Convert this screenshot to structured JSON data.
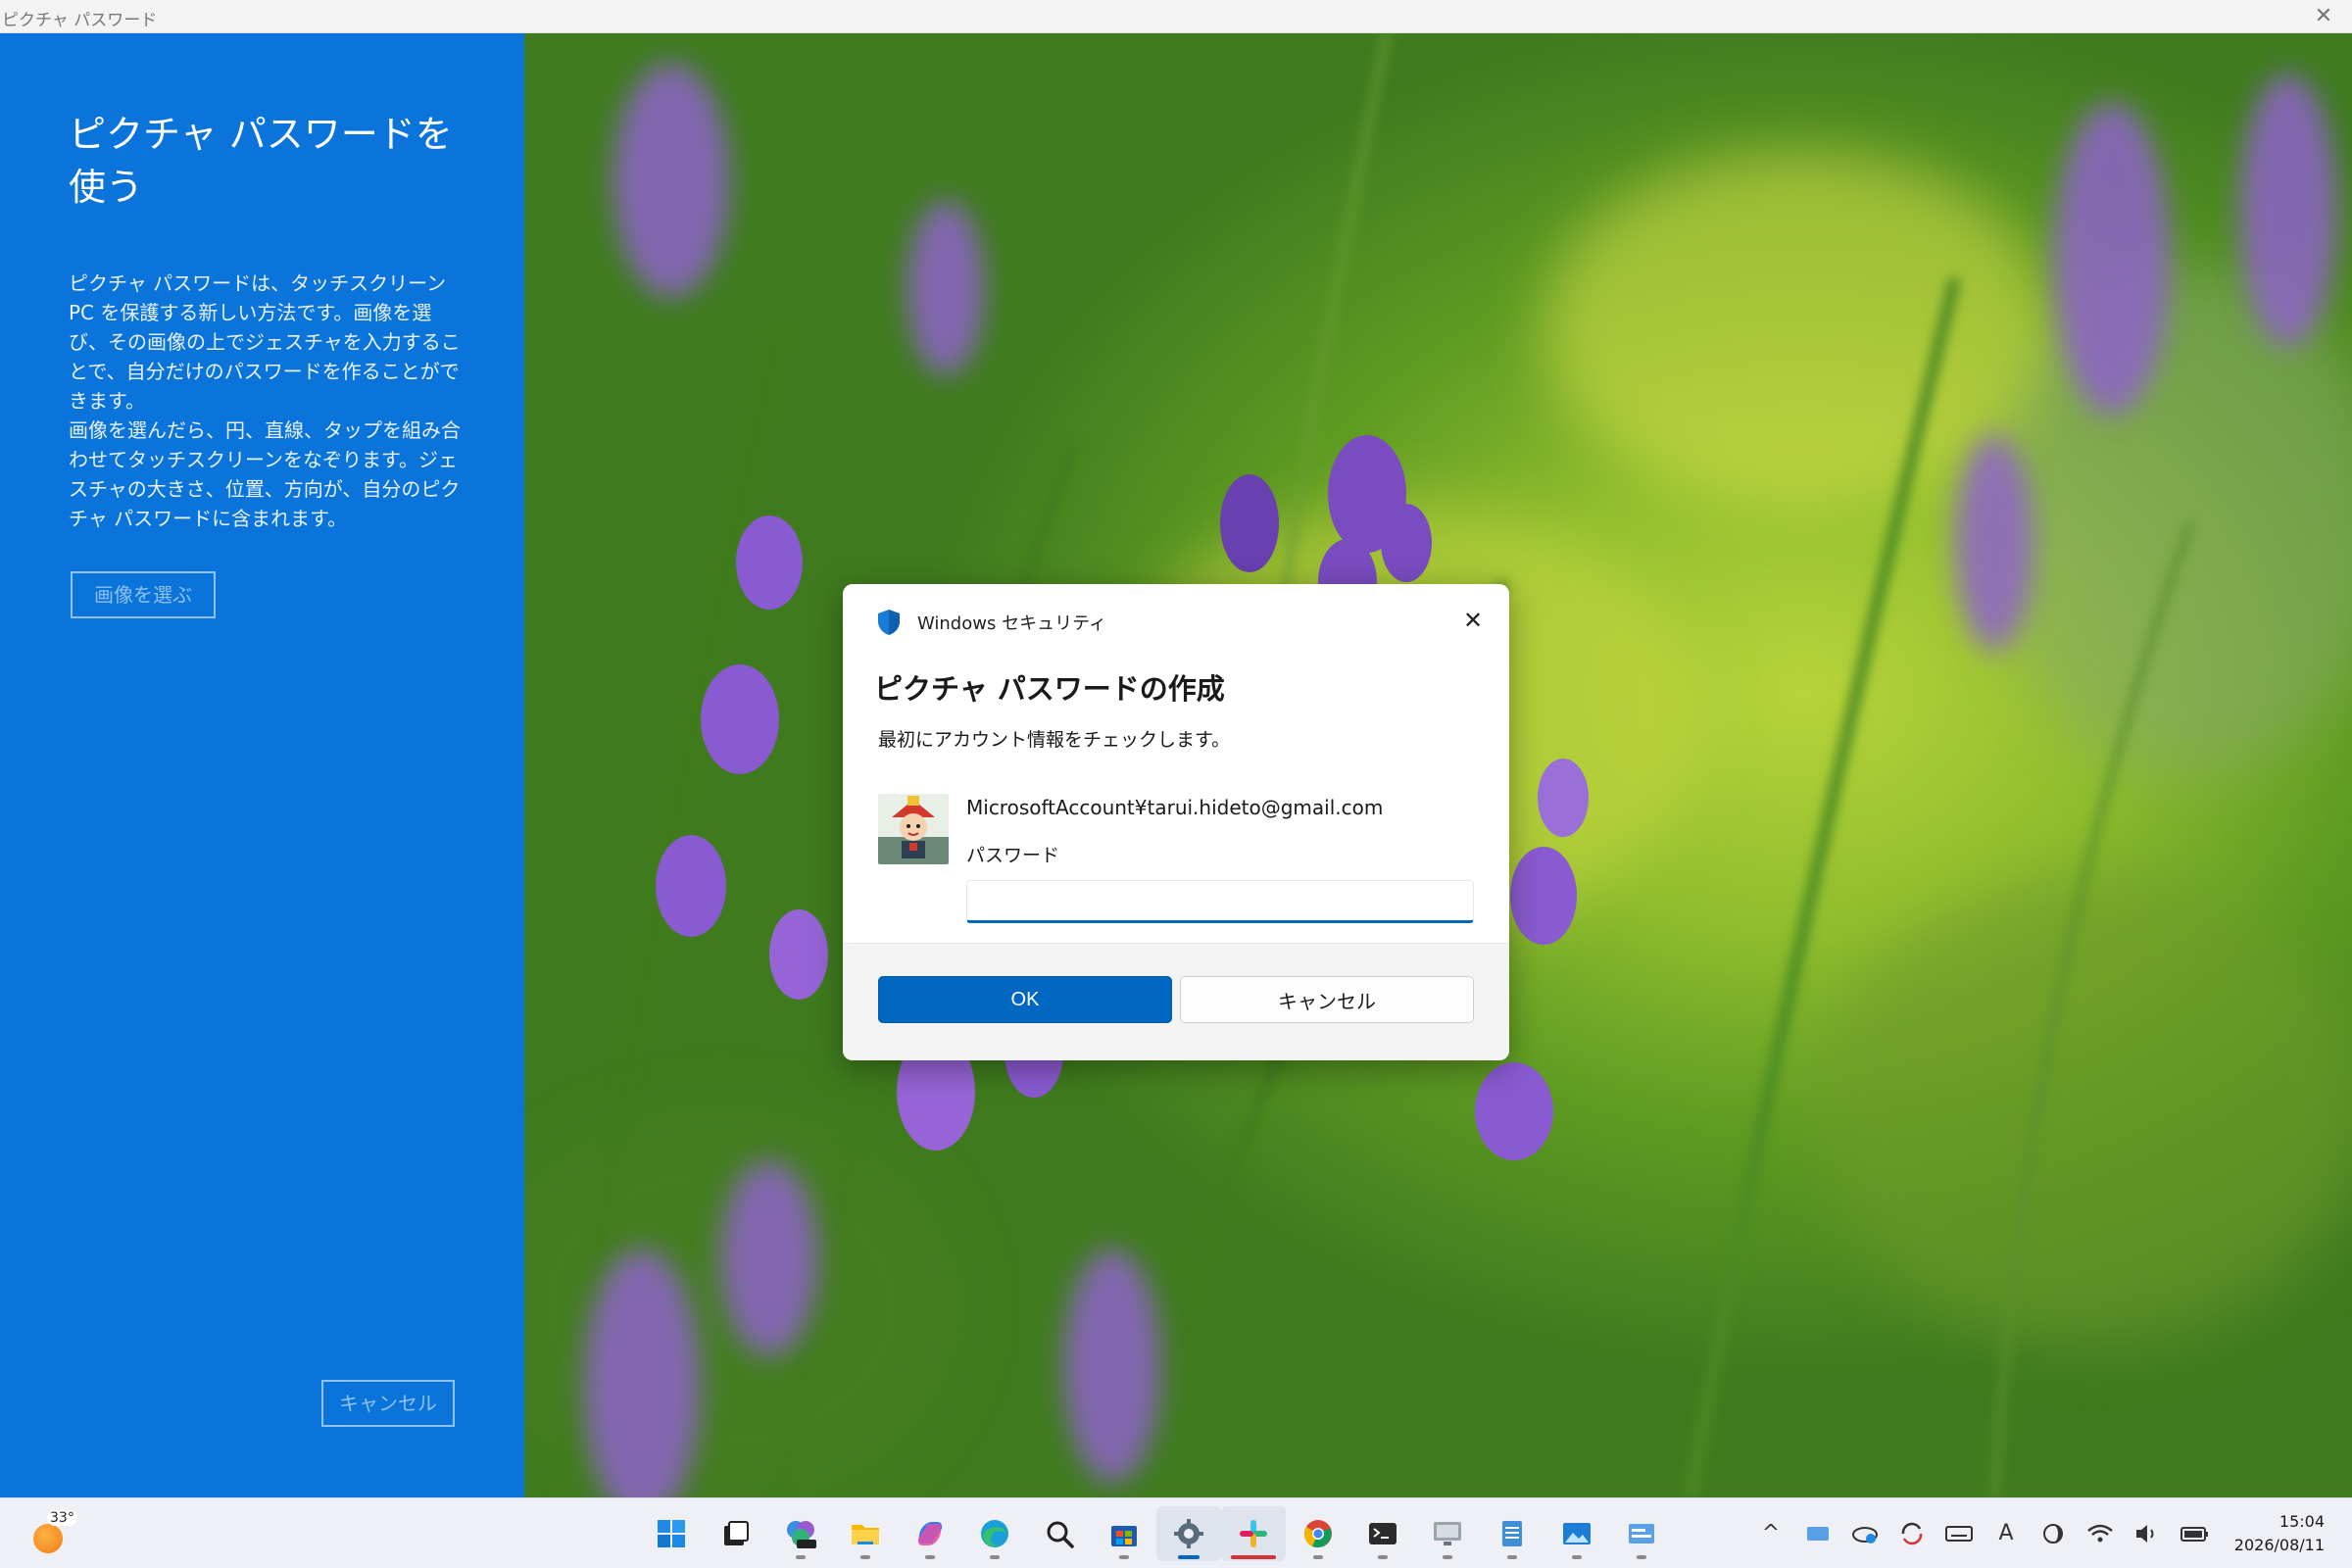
{
  "window": {
    "title": "ピクチャ パスワード",
    "close_glyph": "✕"
  },
  "left_pane": {
    "heading": "ピクチャ パスワードを使う",
    "paragraph1": "ピクチャ パスワードは、タッチスクリーン PC を保護する新しい方法です。画像を選び、その画像の上でジェスチャを入力することで、自分だけのパスワードを作ることができます。",
    "paragraph2": "画像を選んだら、円、直線、タップを組み合わせてタッチスクリーンをなぞります。ジェスチャの大きさ、位置、方向が、自分のピクチャ パスワードに含まれます。",
    "choose_image_label": "画像を選ぶ",
    "cancel_label": "キャンセル"
  },
  "dialog": {
    "app_title": "Windows セキュリティ",
    "close_glyph": "✕",
    "title": "ピクチャ パスワードの作成",
    "subtitle": "最初にアカウント情報をチェックします。",
    "account": "MicrosoftAccount¥tarui.hideto@gmail.com",
    "password_label": "パスワード",
    "password_value": "",
    "ok_label": "OK",
    "cancel_label": "キャンセル",
    "accent_color": "#0067c0"
  },
  "taskbar": {
    "weather_temp": "33°",
    "apps": [
      {
        "name": "start-icon",
        "active": false,
        "indicator": "none"
      },
      {
        "name": "task-view-icon",
        "active": false,
        "indicator": "none"
      },
      {
        "name": "m365-icon",
        "active": false,
        "indicator": "dot"
      },
      {
        "name": "file-explorer-icon",
        "active": false,
        "indicator": "dot"
      },
      {
        "name": "copilot-icon",
        "active": false,
        "indicator": "dot"
      },
      {
        "name": "edge-icon",
        "active": false,
        "indicator": "dot"
      },
      {
        "name": "search-icon",
        "active": false,
        "indicator": "none"
      },
      {
        "name": "store-icon",
        "active": false,
        "indicator": "dot"
      },
      {
        "name": "settings-icon",
        "active": true,
        "indicator": "bar"
      },
      {
        "name": "slack-icon",
        "active": true,
        "indicator": "red"
      },
      {
        "name": "chrome-icon",
        "active": false,
        "indicator": "dot"
      },
      {
        "name": "terminal-icon",
        "active": false,
        "indicator": "dot"
      },
      {
        "name": "remote-desktop-icon",
        "active": false,
        "indicator": "dot"
      },
      {
        "name": "notepad-icon",
        "active": false,
        "indicator": "dot"
      },
      {
        "name": "photos-icon",
        "active": false,
        "indicator": "dot"
      },
      {
        "name": "app-window-icon",
        "active": false,
        "indicator": "dot"
      }
    ],
    "tray_glyphs": {
      "chevron": "^",
      "ime": "A"
    },
    "clock_time": "15:04",
    "clock_date": "2026/08/11"
  }
}
